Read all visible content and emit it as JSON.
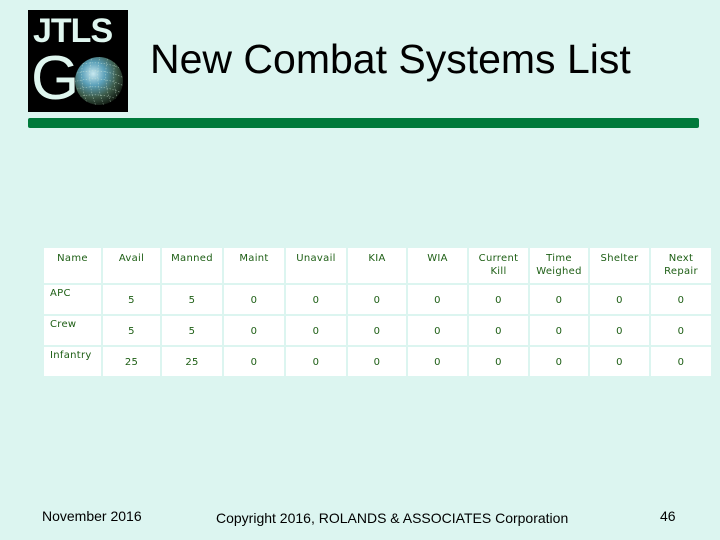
{
  "logo": {
    "line1": "JTLS",
    "line2": "G",
    "globe_icon": "globe-icon"
  },
  "title": "New Combat Systems List",
  "colors": {
    "background": "#dcf5f0",
    "accent_rule": "#007a3b",
    "table_text": "#1d5e14"
  },
  "table": {
    "headers": [
      "Name",
      "Avail",
      "Manned",
      "Maint",
      "Unavail",
      "KIA",
      "WIA",
      "Current Kill",
      "Time Weighed",
      "Shelter",
      "Next Repair"
    ],
    "header_lines": [
      [
        "Name"
      ],
      [
        "Avail"
      ],
      [
        "Manned"
      ],
      [
        "Maint"
      ],
      [
        "Unavail"
      ],
      [
        "KIA"
      ],
      [
        "WIA"
      ],
      [
        "Current",
        "Kill"
      ],
      [
        "Time",
        "Weighed"
      ],
      [
        "Shelter"
      ],
      [
        "Next",
        "Repair"
      ]
    ],
    "rows": [
      [
        "APC",
        "5",
        "5",
        "0",
        "0",
        "0",
        "0",
        "0",
        "0",
        "0",
        "0"
      ],
      [
        "Crew",
        "5",
        "5",
        "0",
        "0",
        "0",
        "0",
        "0",
        "0",
        "0",
        "0"
      ],
      [
        "Infantry",
        "25",
        "25",
        "0",
        "0",
        "0",
        "0",
        "0",
        "0",
        "0",
        "0"
      ]
    ]
  },
  "footer": {
    "date": "November 2016",
    "copyright": "Copyright 2016, ROLANDS & ASSOCIATES Corporation",
    "page": "46"
  }
}
